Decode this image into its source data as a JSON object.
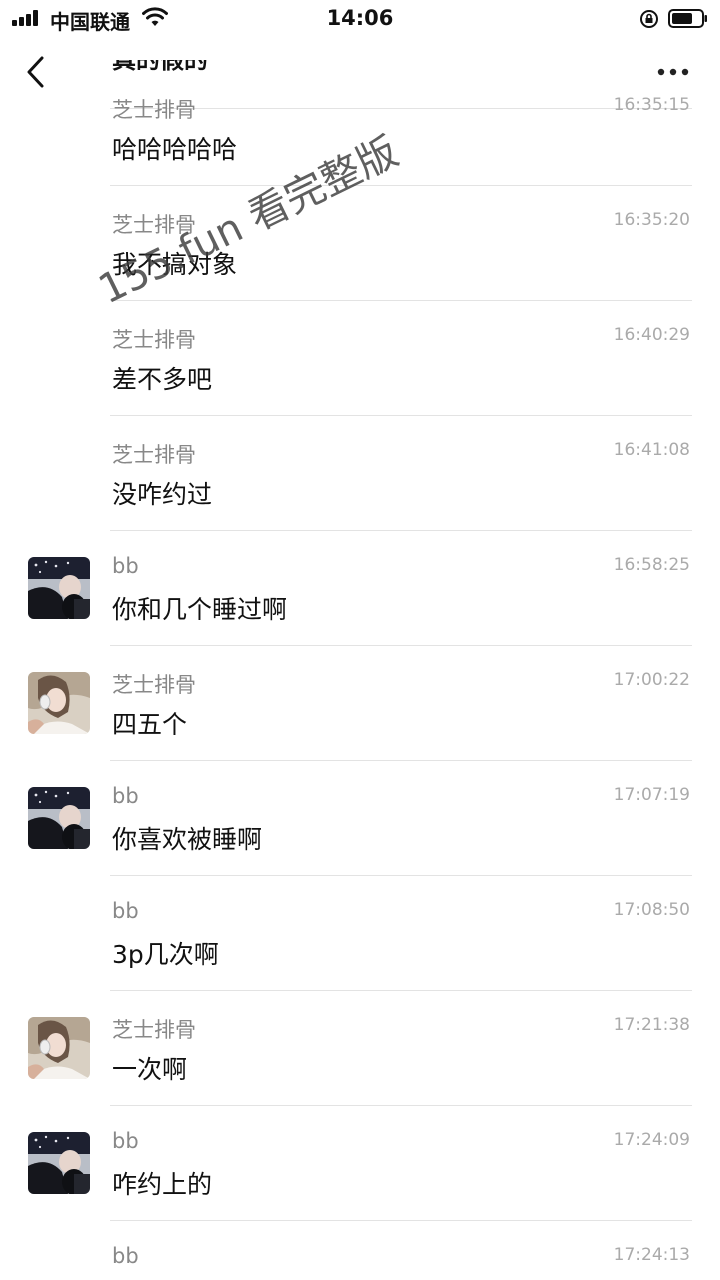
{
  "status_bar": {
    "carrier": "中国联通",
    "time": "14:06"
  },
  "partial_message": "真的假的",
  "watermark": "155.fun 看完整版",
  "messages": [
    {
      "sender": "芝士排骨",
      "time": "16:35:15",
      "text": "哈哈哈哈哈",
      "avatar": "none"
    },
    {
      "sender": "芝士排骨",
      "time": "16:35:20",
      "text": "我不搞对象",
      "avatar": "none"
    },
    {
      "sender": "芝士排骨",
      "time": "16:40:29",
      "text": "差不多吧",
      "avatar": "none"
    },
    {
      "sender": "芝士排骨",
      "time": "16:41:08",
      "text": "没咋约过",
      "avatar": "none"
    },
    {
      "sender": "bb",
      "time": "16:58:25",
      "text": "你和几个睡过啊",
      "avatar": "bb"
    },
    {
      "sender": "芝士排骨",
      "time": "17:00:22",
      "text": "四五个",
      "avatar": "girl"
    },
    {
      "sender": "bb",
      "time": "17:07:19",
      "text": "你喜欢被睡啊",
      "avatar": "bb"
    },
    {
      "sender": "bb",
      "time": "17:08:50",
      "text": "3p几次啊",
      "avatar": "none"
    },
    {
      "sender": "芝士排骨",
      "time": "17:21:38",
      "text": "一次啊",
      "avatar": "girl"
    },
    {
      "sender": "bb",
      "time": "17:24:09",
      "text": "咋约上的",
      "avatar": "bb"
    },
    {
      "sender": "bb",
      "time": "17:24:13",
      "text": "",
      "avatar": "none"
    }
  ],
  "colors": {
    "divider": "#e3e3e3",
    "sender": "#888888",
    "timestamp": "#aaaaaa",
    "text": "#111111"
  }
}
